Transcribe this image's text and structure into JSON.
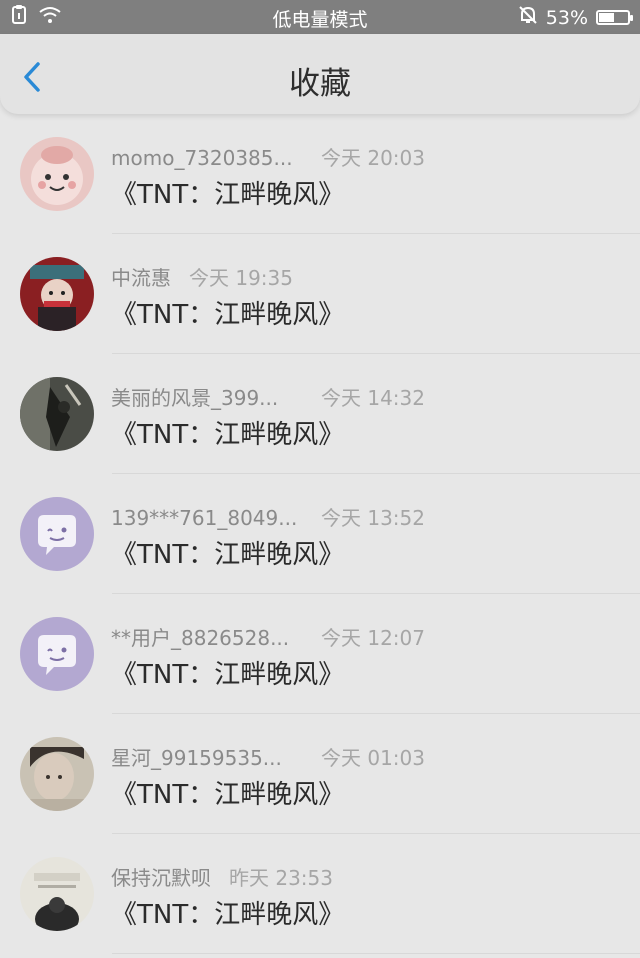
{
  "status_bar": {
    "mode_text": "低电量模式",
    "battery_text": "53%",
    "battery_level": 0.53,
    "icons": [
      "clipboard-icon",
      "wifi-icon",
      "bell-off-icon",
      "battery-icon"
    ]
  },
  "nav": {
    "title": "收藏",
    "back_icon": "chevron-left-icon",
    "accent": "#2a8ad6"
  },
  "items": [
    {
      "name": "momo_7320385...",
      "time": "今天 20:03",
      "content": "《TNT：江畔晚风》",
      "avatar_style": "pink-cartoon"
    },
    {
      "name": "中流惠",
      "time": "今天 19:35",
      "content": "《TNT：江畔晚风》",
      "avatar_style": "red-photo"
    },
    {
      "name": "美丽的风景_399...",
      "time": "今天 14:32",
      "content": "《TNT：江畔晚风》",
      "avatar_style": "dark-photo"
    },
    {
      "name": "139***761_8049...",
      "time": "今天 13:52",
      "content": "《TNT：江畔晚风》",
      "avatar_style": "default-chat"
    },
    {
      "name": "**用户_8826528...",
      "time": "今天 12:07",
      "content": "《TNT：江畔晚风》",
      "avatar_style": "default-chat"
    },
    {
      "name": "星河_99159535...",
      "time": "今天 01:03",
      "content": "《TNT：江畔晚风》",
      "avatar_style": "portrait-photo"
    },
    {
      "name": "保持沉默呗",
      "time": "昨天 23:53",
      "content": "《TNT：江畔晚风》",
      "avatar_style": "light-photo"
    }
  ]
}
